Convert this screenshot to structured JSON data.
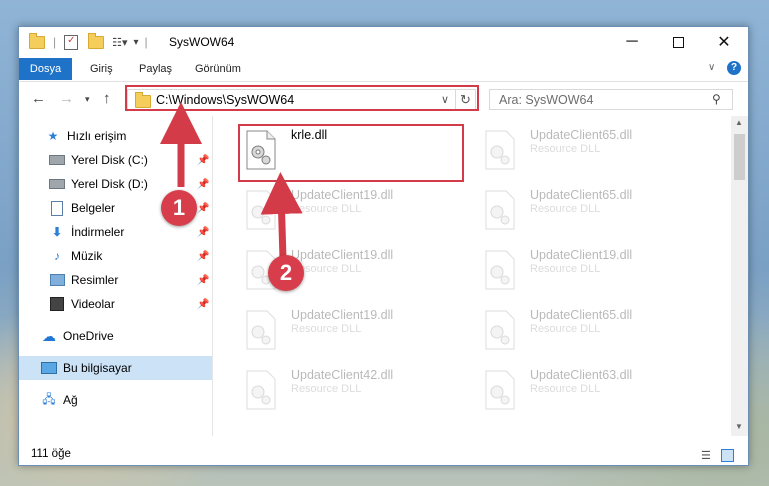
{
  "window": {
    "title": "SysWOW64",
    "minimize_icon": "minimize-icon",
    "maximize_icon": "maximize-icon",
    "close_icon": "close-icon"
  },
  "ribbon": {
    "tabs": [
      "Dosya",
      "Giriş",
      "Paylaş",
      "Görünüm"
    ],
    "accent": "#1e73c8"
  },
  "address": {
    "path": "C:\\Windows\\SysWOW64"
  },
  "search": {
    "placeholder": "Ara: SysWOW64"
  },
  "sidebar": {
    "items": [
      {
        "label": "Hızlı erişim",
        "icon": "star-icon"
      },
      {
        "label": "Yerel Disk (C:)",
        "icon": "drive-icon"
      },
      {
        "label": "Yerel Disk (D:)",
        "icon": "drive-icon"
      },
      {
        "label": "Belgeler",
        "icon": "documents-icon"
      },
      {
        "label": "İndirmeler",
        "icon": "download-icon"
      },
      {
        "label": "Müzik",
        "icon": "music-icon"
      },
      {
        "label": "Resimler",
        "icon": "pictures-icon"
      },
      {
        "label": "Videolar",
        "icon": "videos-icon"
      },
      {
        "label": "OneDrive",
        "icon": "cloud-icon"
      },
      {
        "label": "Bu bilgisayar",
        "icon": "computer-icon"
      },
      {
        "label": "Ağ",
        "icon": "network-icon"
      }
    ]
  },
  "files": [
    {
      "name": "krle.dll",
      "type": ""
    },
    {
      "name": "UpdateClient65.dll",
      "type": "Resource DLL"
    },
    {
      "name": "UpdateClient19.dll",
      "type": "Resource DLL"
    },
    {
      "name": "UpdateClient65.dll",
      "type": "Resource DLL"
    },
    {
      "name": "UpdateClient19.dll",
      "type": "Resource DLL"
    },
    {
      "name": "UpdateClient19.dll",
      "type": "Resource DLL"
    },
    {
      "name": "UpdateClient19.dll",
      "type": "Resource DLL"
    },
    {
      "name": "UpdateClient65.dll",
      "type": "Resource DLL"
    },
    {
      "name": "UpdateClient42.dll",
      "type": "Resource DLL"
    },
    {
      "name": "UpdateClient63.dll",
      "type": "Resource DLL"
    }
  ],
  "status": {
    "count": "111 öğe"
  },
  "annotations": {
    "step1": "1",
    "step2": "2",
    "color": "#d23b47"
  }
}
